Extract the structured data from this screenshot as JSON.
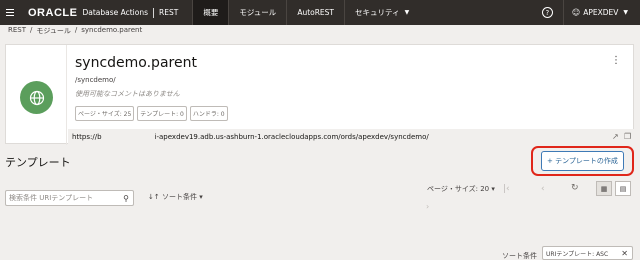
{
  "topbar": {
    "logo": "ORACLE",
    "product": "Database Actions",
    "section": "REST",
    "nav": [
      {
        "label": "概要"
      },
      {
        "label": "モジュール"
      },
      {
        "label": "AutoREST"
      },
      {
        "label": "セキュリティ"
      }
    ],
    "help": "?",
    "user": "APEXDEV"
  },
  "breadcrumb": {
    "items": [
      "REST",
      "/",
      "モジュール",
      "/",
      "syncdemo.parent"
    ]
  },
  "module": {
    "title": "syncdemo.parent",
    "path": "/syncdemo/",
    "comment": "使用可能なコメントはありません",
    "badges": [
      "ページ・サイズ: 25",
      "テンプレート: 0",
      "ハンドラ: 0"
    ],
    "url_prefix": "https://b",
    "url_rest": "i-apexdev19.adb.us-ashburn-1.oraclecloudapps.com/ords/apexdev/syncdemo/"
  },
  "templates": {
    "heading": "テンプレート",
    "create_button": "テンプレートの作成",
    "search_placeholder": "検索条件 URIテンプレート",
    "sort_label": "ソート条件",
    "page_size_label": "ページ・サイズ: 20",
    "sort_condition_label": "ソート条件",
    "sort_chip": "URIテンプレート: ASC"
  },
  "colors": {
    "header_bg": "#312d2a",
    "accent": "#2a6496",
    "highlight": "#e0261a",
    "icon_green": "#5b9e5c"
  }
}
